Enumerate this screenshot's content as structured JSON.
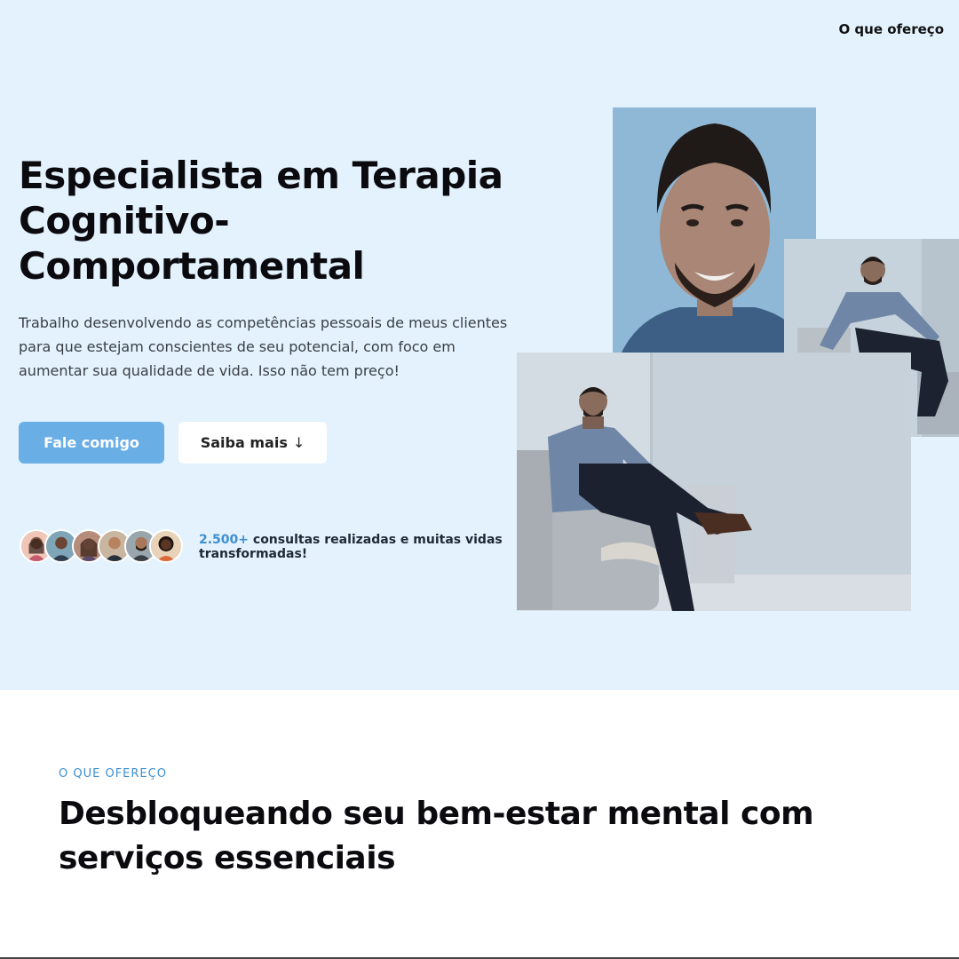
{
  "nav": {
    "offer_link": "O que ofereço"
  },
  "hero": {
    "title": "Especialista em Terapia Cognitivo-Comportamental",
    "description": "Trabalho desenvolvendo as competências pessoais de meus clientes para que estejam conscientes de seu potencial, com foco em aumentar sua qualidade de vida. Isso não tem preço!",
    "primary_button": "Fale comigo",
    "secondary_button": "Saiba mais",
    "secondary_arrow": "↓",
    "stats_number": "2.500+",
    "stats_text": " consultas realizadas e muitas vidas transformadas!"
  },
  "section": {
    "label": "O QUE OFEREÇO",
    "title": "Desbloqueando seu bem-estar mental com serviços essenciais"
  },
  "colors": {
    "hero_bg": "#e3f2fd",
    "accent": "#3f8fd1",
    "primary_button": "#6aaee6"
  }
}
